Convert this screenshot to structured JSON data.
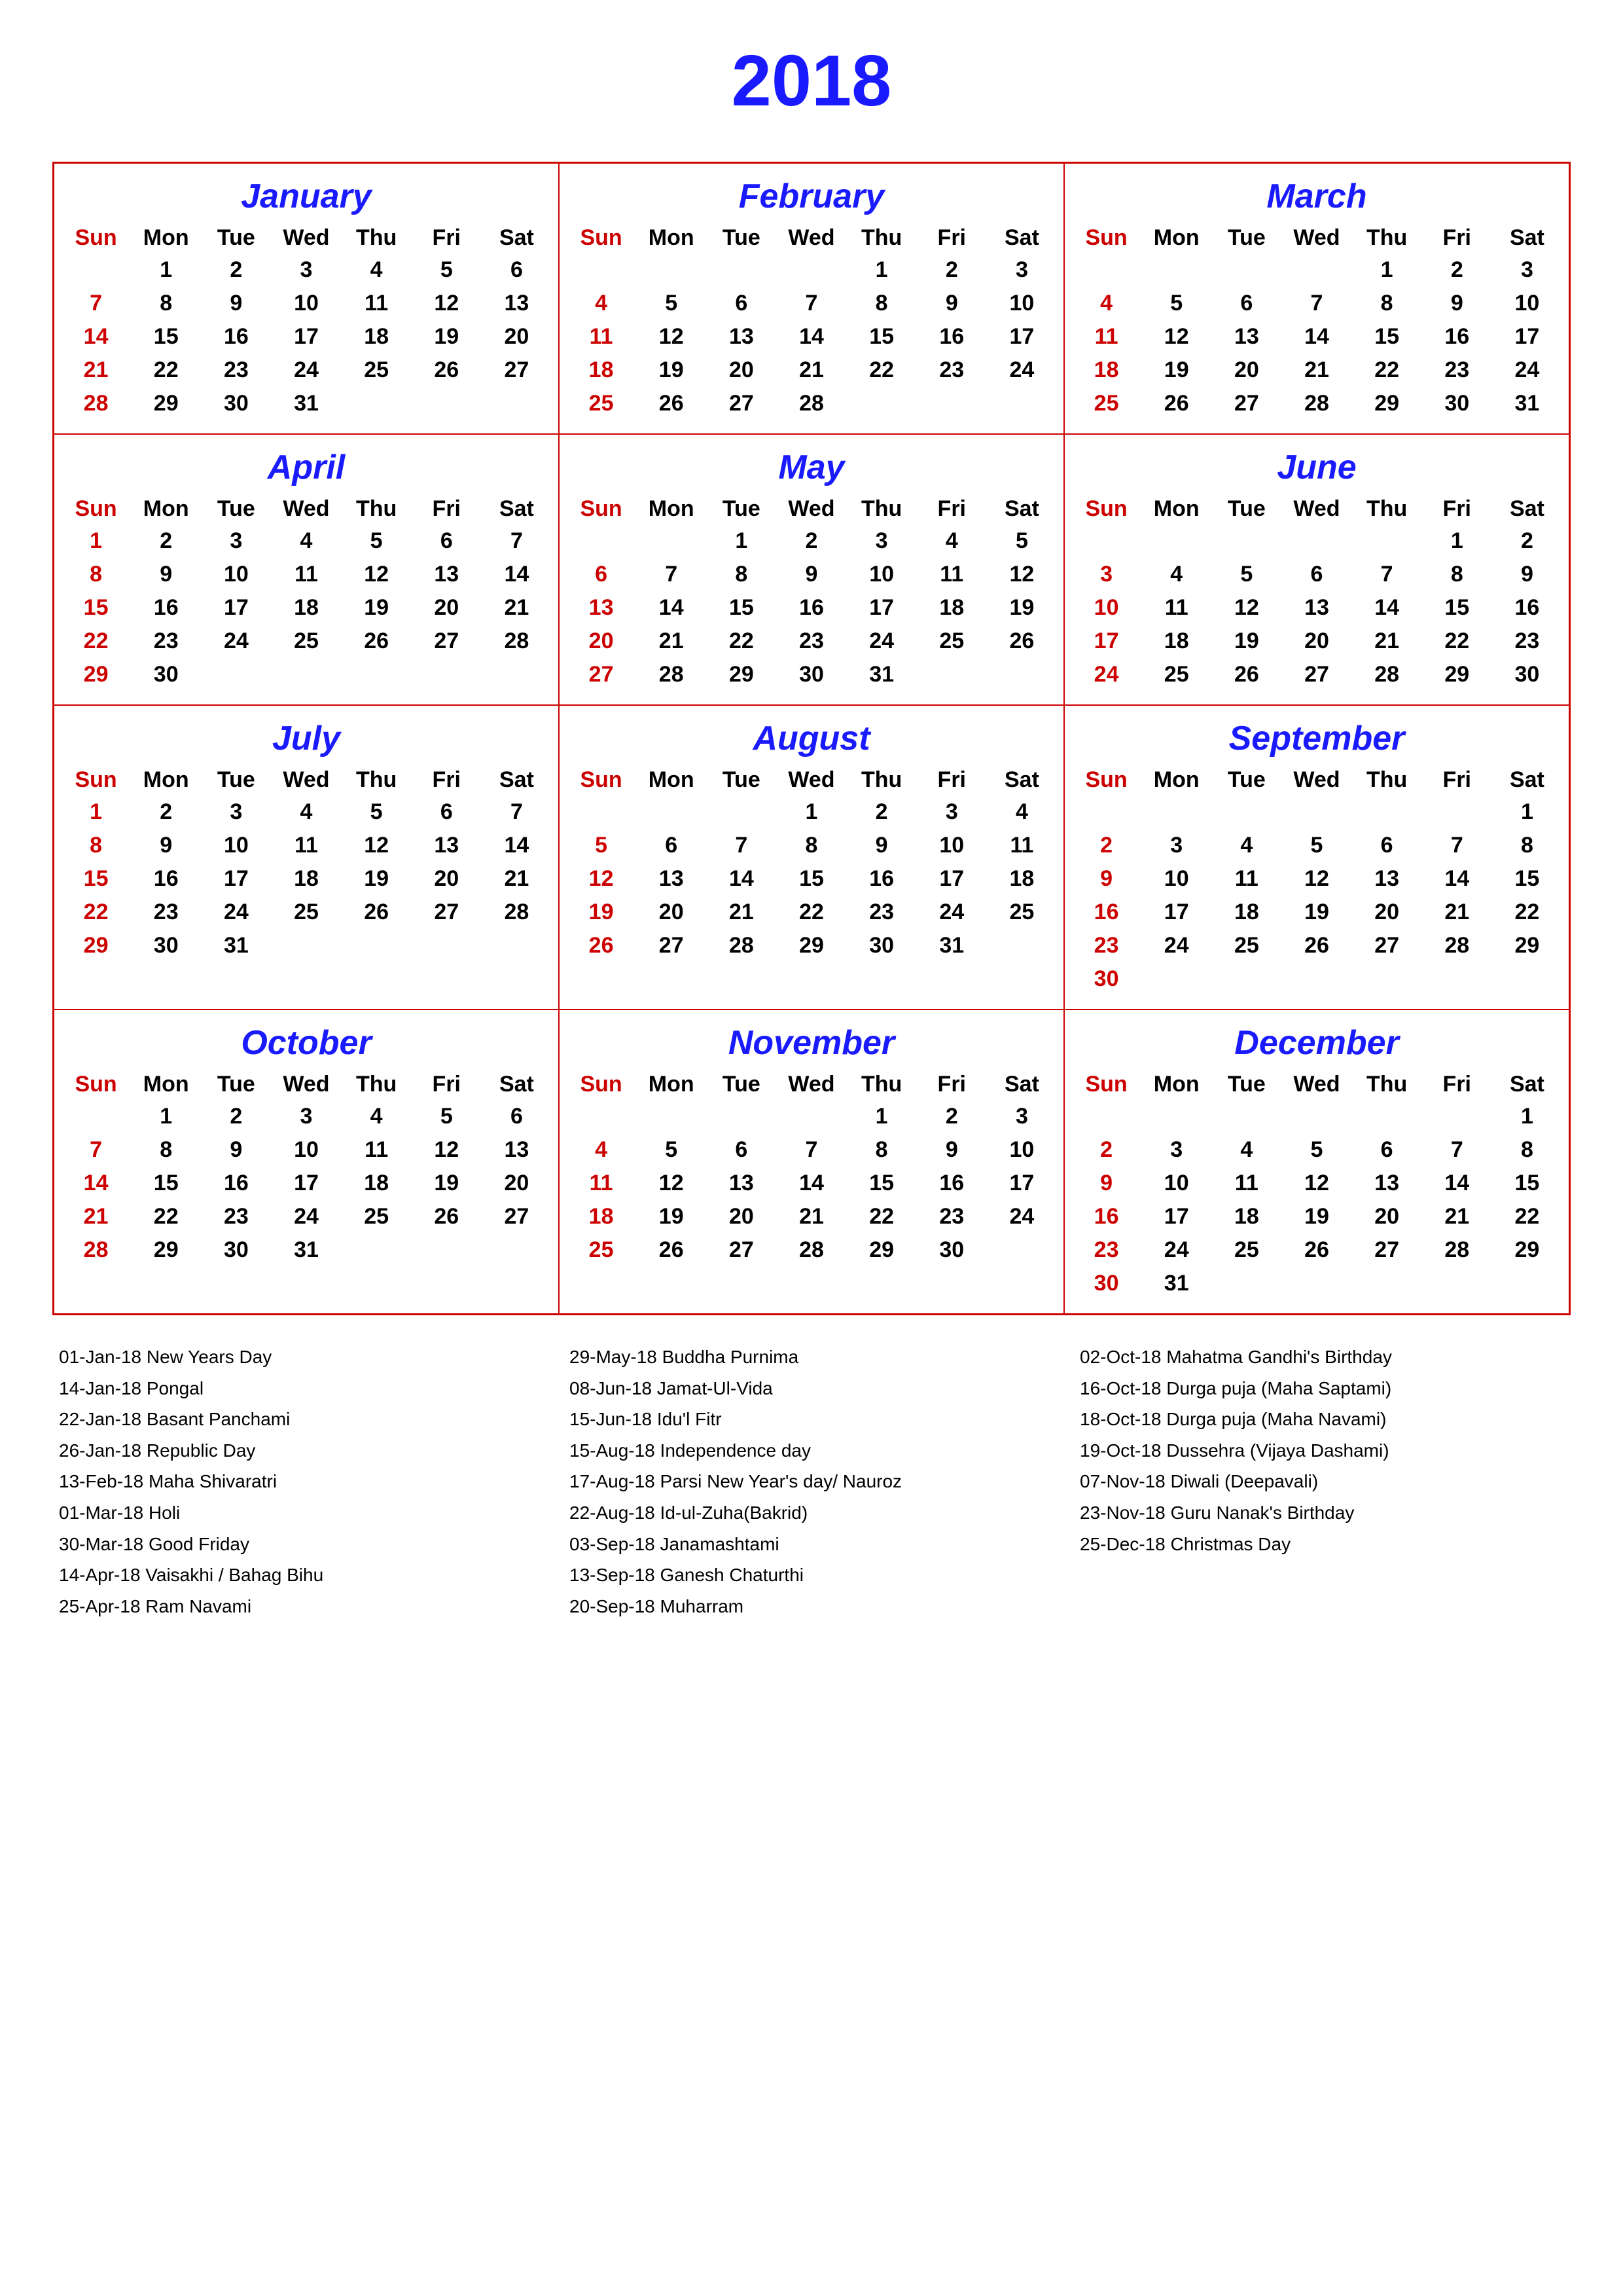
{
  "title": "2018",
  "months": [
    {
      "name": "January",
      "startDay": 1,
      "days": 31,
      "weeks": [
        [
          "",
          "1",
          "2",
          "3",
          "4",
          "5",
          "6"
        ],
        [
          "7",
          "8",
          "9",
          "10",
          "11",
          "12",
          "13"
        ],
        [
          "14",
          "15",
          "16",
          "17",
          "18",
          "19",
          "20"
        ],
        [
          "21",
          "22",
          "23",
          "24",
          "25",
          "26",
          "27"
        ],
        [
          "28",
          "29",
          "30",
          "31",
          "",
          "",
          ""
        ]
      ]
    },
    {
      "name": "February",
      "startDay": 4,
      "days": 28,
      "weeks": [
        [
          "",
          "",
          "",
          "",
          "1",
          "2",
          "3"
        ],
        [
          "4",
          "5",
          "6",
          "7",
          "8",
          "9",
          "10"
        ],
        [
          "11",
          "12",
          "13",
          "14",
          "15",
          "16",
          "17"
        ],
        [
          "18",
          "19",
          "20",
          "21",
          "22",
          "23",
          "24"
        ],
        [
          "25",
          "26",
          "27",
          "28",
          "",
          "",
          ""
        ]
      ]
    },
    {
      "name": "March",
      "startDay": 4,
      "days": 31,
      "weeks": [
        [
          "",
          "",
          "",
          "",
          "1",
          "2",
          "3"
        ],
        [
          "4",
          "5",
          "6",
          "7",
          "8",
          "9",
          "10"
        ],
        [
          "11",
          "12",
          "13",
          "14",
          "15",
          "16",
          "17"
        ],
        [
          "18",
          "19",
          "20",
          "21",
          "22",
          "23",
          "24"
        ],
        [
          "25",
          "26",
          "27",
          "28",
          "29",
          "30",
          "31"
        ]
      ]
    },
    {
      "name": "April",
      "startDay": 0,
      "days": 30,
      "weeks": [
        [
          "1",
          "2",
          "3",
          "4",
          "5",
          "6",
          "7"
        ],
        [
          "8",
          "9",
          "10",
          "11",
          "12",
          "13",
          "14"
        ],
        [
          "15",
          "16",
          "17",
          "18",
          "19",
          "20",
          "21"
        ],
        [
          "22",
          "23",
          "24",
          "25",
          "26",
          "27",
          "28"
        ],
        [
          "29",
          "30",
          "",
          "",
          "",
          "",
          ""
        ]
      ]
    },
    {
      "name": "May",
      "startDay": 2,
      "days": 31,
      "weeks": [
        [
          "",
          "",
          "1",
          "2",
          "3",
          "4",
          "5"
        ],
        [
          "6",
          "7",
          "8",
          "9",
          "10",
          "11",
          "12"
        ],
        [
          "13",
          "14",
          "15",
          "16",
          "17",
          "18",
          "19"
        ],
        [
          "20",
          "21",
          "22",
          "23",
          "24",
          "25",
          "26"
        ],
        [
          "27",
          "28",
          "29",
          "30",
          "31",
          "",
          ""
        ]
      ]
    },
    {
      "name": "June",
      "startDay": 5,
      "days": 30,
      "weeks": [
        [
          "",
          "",
          "",
          "",
          "",
          "1",
          "2"
        ],
        [
          "3",
          "4",
          "5",
          "6",
          "7",
          "8",
          "9"
        ],
        [
          "10",
          "11",
          "12",
          "13",
          "14",
          "15",
          "16"
        ],
        [
          "17",
          "18",
          "19",
          "20",
          "21",
          "22",
          "23"
        ],
        [
          "24",
          "25",
          "26",
          "27",
          "28",
          "29",
          "30"
        ]
      ]
    },
    {
      "name": "July",
      "startDay": 0,
      "days": 31,
      "weeks": [
        [
          "1",
          "2",
          "3",
          "4",
          "5",
          "6",
          "7"
        ],
        [
          "8",
          "9",
          "10",
          "11",
          "12",
          "13",
          "14"
        ],
        [
          "15",
          "16",
          "17",
          "18",
          "19",
          "20",
          "21"
        ],
        [
          "22",
          "23",
          "24",
          "25",
          "26",
          "27",
          "28"
        ],
        [
          "29",
          "30",
          "31",
          "",
          "",
          "",
          ""
        ]
      ]
    },
    {
      "name": "August",
      "startDay": 3,
      "days": 31,
      "weeks": [
        [
          "",
          "",
          "",
          "1",
          "2",
          "3",
          "4"
        ],
        [
          "5",
          "6",
          "7",
          "8",
          "9",
          "10",
          "11"
        ],
        [
          "12",
          "13",
          "14",
          "15",
          "16",
          "17",
          "18"
        ],
        [
          "19",
          "20",
          "21",
          "22",
          "23",
          "24",
          "25"
        ],
        [
          "26",
          "27",
          "28",
          "29",
          "30",
          "31",
          ""
        ]
      ]
    },
    {
      "name": "September",
      "startDay": 6,
      "days": 30,
      "weeks": [
        [
          "",
          "",
          "",
          "",
          "",
          "",
          "1"
        ],
        [
          "2",
          "3",
          "4",
          "5",
          "6",
          "7",
          "8"
        ],
        [
          "9",
          "10",
          "11",
          "12",
          "13",
          "14",
          "15"
        ],
        [
          "16",
          "17",
          "18",
          "19",
          "20",
          "21",
          "22"
        ],
        [
          "23",
          "24",
          "25",
          "26",
          "27",
          "28",
          "29"
        ],
        [
          "30",
          "",
          "",
          "",
          "",
          "",
          ""
        ]
      ]
    },
    {
      "name": "October",
      "startDay": 1,
      "days": 31,
      "weeks": [
        [
          "",
          "1",
          "2",
          "3",
          "4",
          "5",
          "6"
        ],
        [
          "7",
          "8",
          "9",
          "10",
          "11",
          "12",
          "13"
        ],
        [
          "14",
          "15",
          "16",
          "17",
          "18",
          "19",
          "20"
        ],
        [
          "21",
          "22",
          "23",
          "24",
          "25",
          "26",
          "27"
        ],
        [
          "28",
          "29",
          "30",
          "31",
          "",
          "",
          ""
        ]
      ]
    },
    {
      "name": "November",
      "startDay": 4,
      "days": 30,
      "weeks": [
        [
          "",
          "",
          "",
          "",
          "1",
          "2",
          "3"
        ],
        [
          "4",
          "5",
          "6",
          "7",
          "8",
          "9",
          "10"
        ],
        [
          "11",
          "12",
          "13",
          "14",
          "15",
          "16",
          "17"
        ],
        [
          "18",
          "19",
          "20",
          "21",
          "22",
          "23",
          "24"
        ],
        [
          "25",
          "26",
          "27",
          "28",
          "29",
          "30",
          ""
        ]
      ]
    },
    {
      "name": "December",
      "startDay": 6,
      "days": 31,
      "weeks": [
        [
          "",
          "",
          "",
          "",
          "",
          "",
          "1"
        ],
        [
          "2",
          "3",
          "4",
          "5",
          "6",
          "7",
          "8"
        ],
        [
          "9",
          "10",
          "11",
          "12",
          "13",
          "14",
          "15"
        ],
        [
          "16",
          "17",
          "18",
          "19",
          "20",
          "21",
          "22"
        ],
        [
          "23",
          "24",
          "25",
          "26",
          "27",
          "28",
          "29"
        ],
        [
          "30",
          "31",
          "",
          "",
          "",
          "",
          ""
        ]
      ]
    }
  ],
  "dayHeaders": [
    "Sun",
    "Mon",
    "Tue",
    "Wed",
    "Thu",
    "Fri",
    "Sat"
  ],
  "holidays": {
    "col1": [
      "01-Jan-18 New Years Day",
      "14-Jan-18 Pongal",
      "22-Jan-18 Basant Panchami",
      "26-Jan-18 Republic Day",
      "13-Feb-18 Maha Shivaratri",
      "01-Mar-18 Holi",
      "30-Mar-18 Good Friday",
      "14-Apr-18 Vaisakhi / Bahag Bihu",
      "25-Apr-18 Ram Navami"
    ],
    "col2": [
      "29-May-18 Buddha Purnima",
      "08-Jun-18 Jamat-Ul-Vida",
      "15-Jun-18 Idu'l Fitr",
      "15-Aug-18 Independence day",
      "17-Aug-18 Parsi New Year's day/ Nauroz",
      "22-Aug-18 Id-ul-Zuha(Bakrid)",
      "03-Sep-18 Janamashtami",
      "13-Sep-18 Ganesh Chaturthi",
      "20-Sep-18 Muharram"
    ],
    "col3": [
      "02-Oct-18 Mahatma Gandhi's Birthday",
      "16-Oct-18 Durga puja (Maha Saptami)",
      "18-Oct-18 Durga puja (Maha Navami)",
      "19-Oct-18 Dussehra (Vijaya Dashami)",
      "07-Nov-18 Diwali (Deepavali)",
      "23-Nov-18 Guru Nanak's Birthday",
      "25-Dec-18 Christmas Day"
    ]
  }
}
